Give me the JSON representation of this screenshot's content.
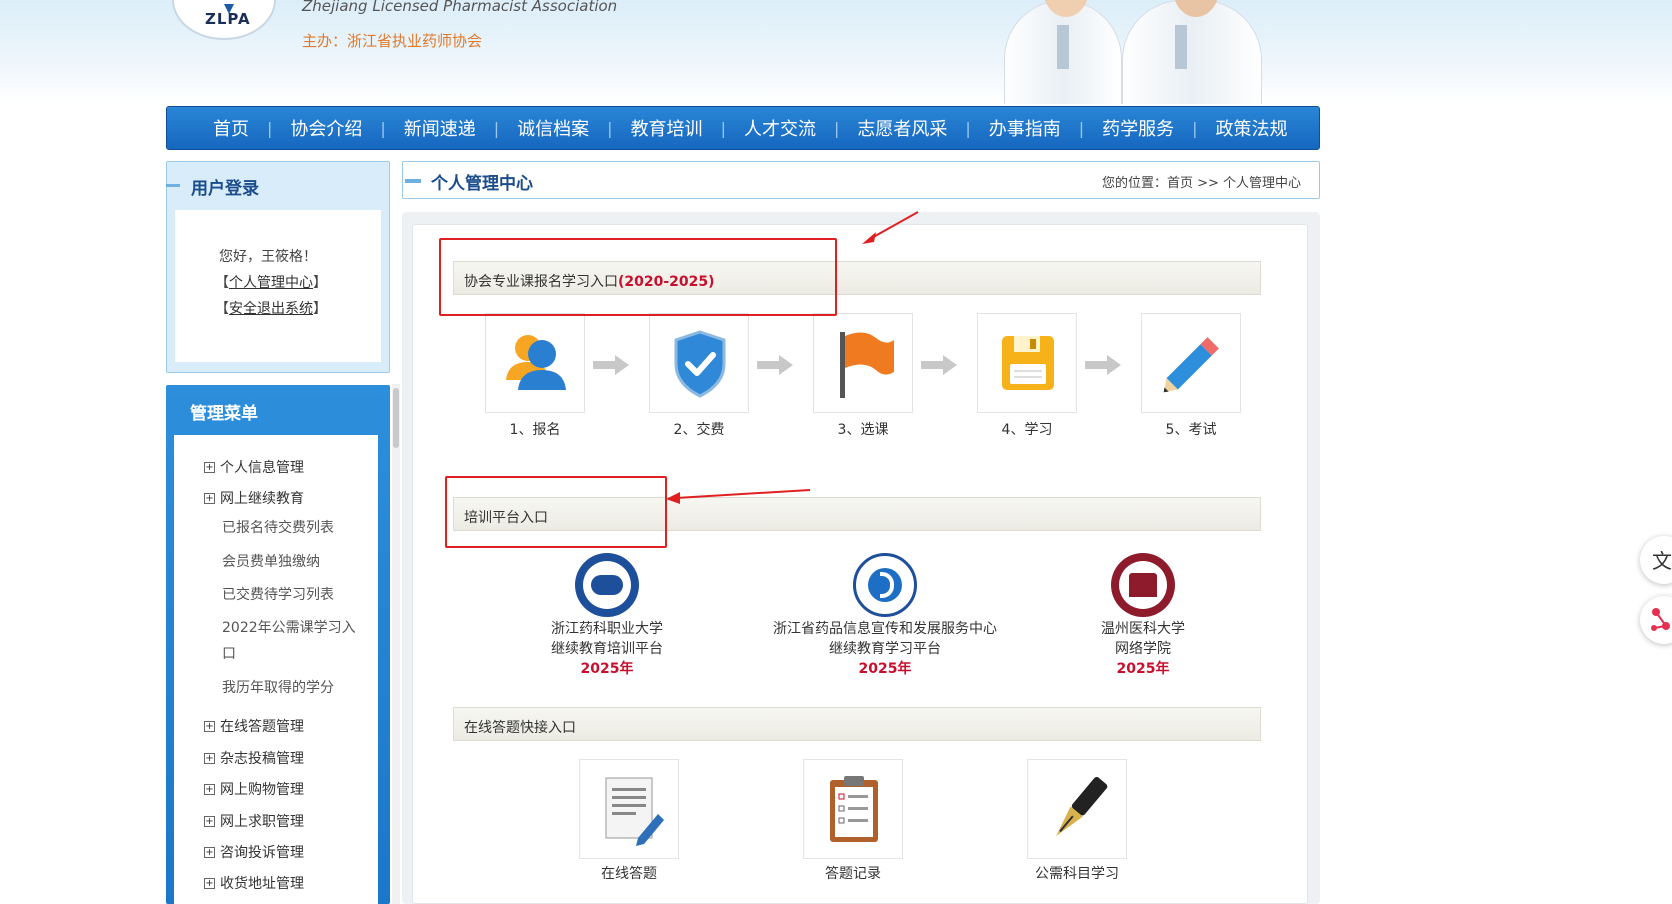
{
  "header": {
    "logo_text": "ZLPA",
    "association_en": "Zhejiang Licensed Pharmacist Association",
    "host": "主办：浙江省执业药师协会"
  },
  "nav": {
    "items": [
      {
        "label": "首页"
      },
      {
        "label": "协会介绍"
      },
      {
        "label": "新闻速递"
      },
      {
        "label": "诚信档案"
      },
      {
        "label": "教育培训"
      },
      {
        "label": "人才交流"
      },
      {
        "label": "志愿者风采"
      },
      {
        "label": "办事指南"
      },
      {
        "label": "药学服务"
      },
      {
        "label": "政策法规"
      }
    ],
    "separator": "|"
  },
  "login": {
    "title": "用户登录",
    "greeting": "您好，王筱格！",
    "bracket_open": "【",
    "bracket_close": "】",
    "personal_center_link": "个人管理中心",
    "logout_link": "安全退出系统"
  },
  "menu": {
    "title": "管理菜单",
    "expander": "+",
    "groups": [
      {
        "label": "个人信息管理"
      },
      {
        "label": "网上继续教育"
      },
      {
        "label": "在线答题管理"
      },
      {
        "label": "杂志投稿管理"
      },
      {
        "label": "网上购物管理"
      },
      {
        "label": "网上求职管理"
      },
      {
        "label": "咨询投诉管理"
      },
      {
        "label": "收货地址管理"
      }
    ],
    "sub_items": [
      {
        "label": "已报名待交费列表"
      },
      {
        "label": "会员费单独缴纳"
      },
      {
        "label": "已交费待学习列表"
      },
      {
        "label": "2022年公需课学习入口"
      },
      {
        "label": "我历年取得的学分"
      }
    ]
  },
  "main": {
    "title": "个人管理中心",
    "breadcrumb": "您的位置：首页 >> 个人管理中心",
    "section1": {
      "title": "协会专业课报名学习入口",
      "title_highlight": "(2020-2025)"
    },
    "steps": [
      {
        "label": "1、报名",
        "icon": "user-icon"
      },
      {
        "label": "2、交费",
        "icon": "shield-check-icon"
      },
      {
        "label": "3、选课",
        "icon": "flag-icon"
      },
      {
        "label": "4、学习",
        "icon": "floppy-disk-icon"
      },
      {
        "label": "5、考试",
        "icon": "pencil-icon"
      }
    ],
    "section2": {
      "title": "培训平台入口"
    },
    "platforms": [
      {
        "line1": "浙江药科职业大学",
        "line2": "继续教育培训平台",
        "year": "2025年"
      },
      {
        "line1": "浙江省药品信息宣传和发展服务中心",
        "line2": "继续教育学习平台",
        "year": "2025年"
      },
      {
        "line1": "温州医科大学",
        "line2": "网络学院",
        "year": "2025年"
      }
    ],
    "section3": {
      "title": "在线答题快接入口"
    },
    "quick_links": [
      {
        "label": "在线答题",
        "icon": "document-pen-icon"
      },
      {
        "label": "答题记录",
        "icon": "clipboard-list-icon"
      },
      {
        "label": "公需科目学习",
        "icon": "fountain-pen-icon"
      }
    ]
  },
  "colors": {
    "nav_blue": "#1a6fc6",
    "title_blue": "#1b4d8c",
    "highlight_red": "#c8102e",
    "annotation_red": "#e02020",
    "host_orange": "#e07a2c"
  }
}
